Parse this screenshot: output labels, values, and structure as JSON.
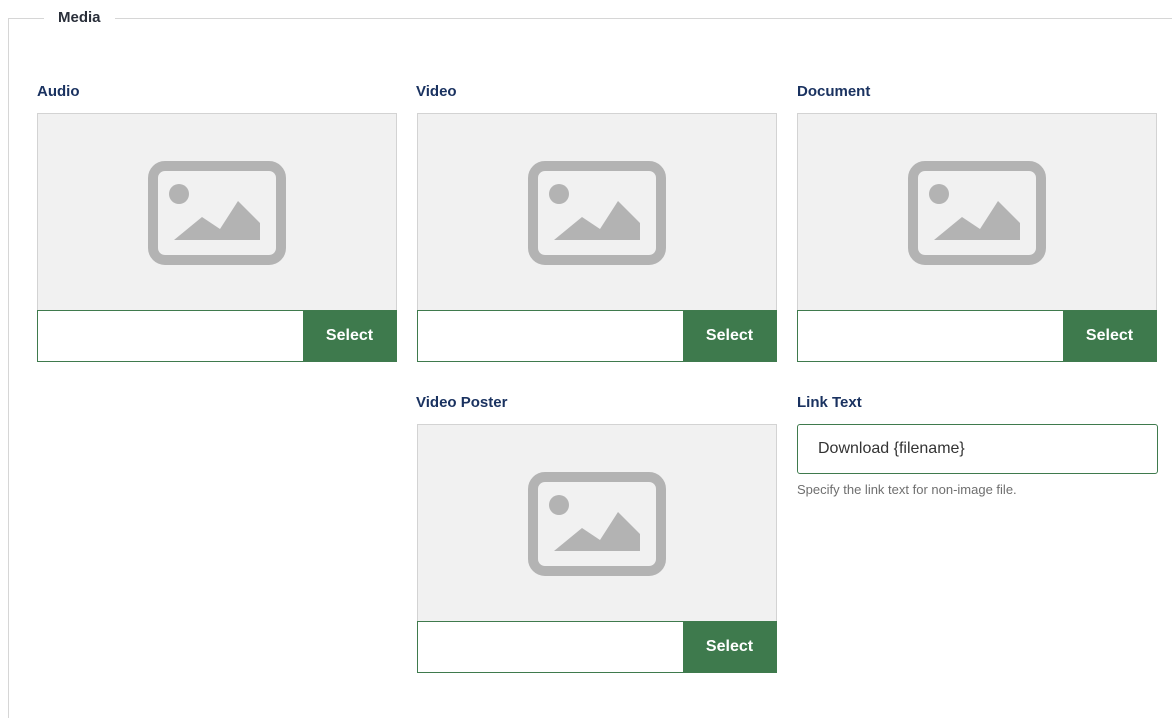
{
  "fieldset": {
    "legend": "Media"
  },
  "fields": {
    "audio": {
      "label": "Audio",
      "value": "",
      "button": "Select"
    },
    "video": {
      "label": "Video",
      "value": "",
      "button": "Select"
    },
    "document": {
      "label": "Document",
      "value": "",
      "button": "Select"
    },
    "video_poster": {
      "label": "Video Poster",
      "value": "",
      "button": "Select"
    },
    "link_text": {
      "label": "Link Text",
      "value": "Download {filename}",
      "help": "Specify the link text for non-image file."
    }
  },
  "icons": {
    "preview": "image-placeholder-icon"
  },
  "colors": {
    "accent": "#3e7a4d",
    "label": "#1a3260",
    "preview_bg": "#f1f1f1",
    "icon": "#b3b3b3"
  }
}
